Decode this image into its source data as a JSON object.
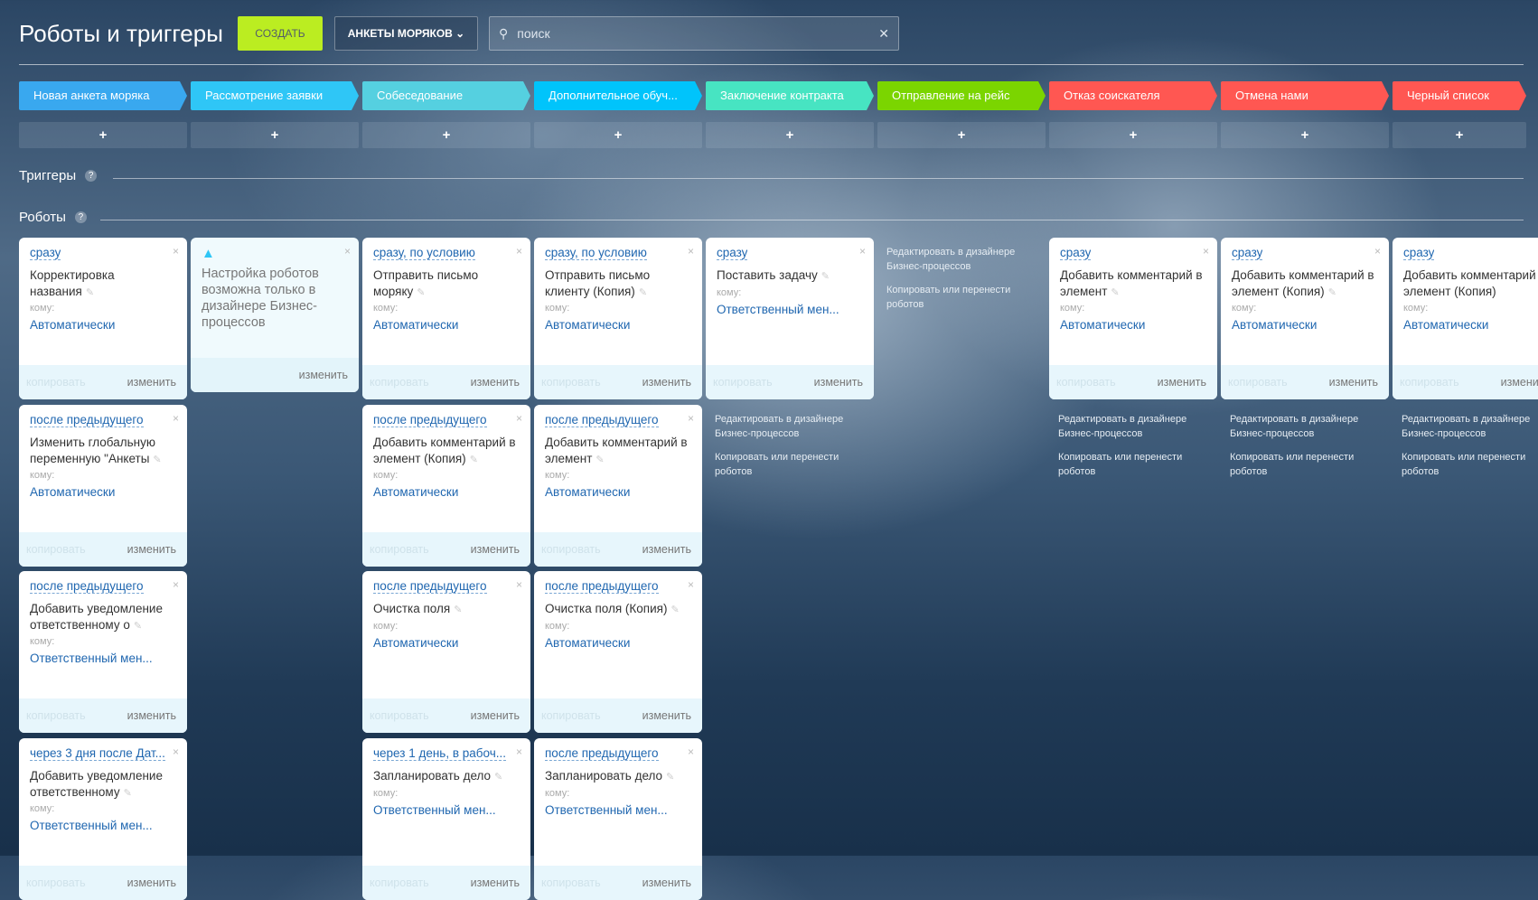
{
  "header": {
    "title": "Роботы и триггеры",
    "create_label": "СОЗДАТЬ",
    "dropdown_label": "АНКЕТЫ МОРЯКОВ",
    "search_placeholder": "поиск"
  },
  "stages": [
    {
      "label": "Новая анкета моряка",
      "color": "#39a8ef"
    },
    {
      "label": "Рассмотрение заявки",
      "color": "#2fc6f6"
    },
    {
      "label": "Собеседование",
      "color": "#55d0e0"
    },
    {
      "label": "Дополнительное обуч...",
      "color": "#00c4fb"
    },
    {
      "label": "Заключение контракта",
      "color": "#47e4c2"
    },
    {
      "label": "Отправление на рейс",
      "color": "#7bd500"
    },
    {
      "label": "Отказ соискателя",
      "color": "#ff5752"
    },
    {
      "label": "Отмена нами",
      "color": "#ff5752"
    },
    {
      "label": "Черный список",
      "color": "#ff5752"
    }
  ],
  "add_label": "+",
  "sections": {
    "triggers": "Триггеры",
    "robots": "Роботы",
    "help": "?"
  },
  "card_labels": {
    "to": "кому:",
    "copy": "копировать",
    "edit": "изменить",
    "close": "×",
    "pencil": "✎"
  },
  "warning": {
    "text": "Настройка роботов возможна только в дизайнере Бизнес-процессов",
    "edit": "изменить"
  },
  "links": {
    "edit_designer": "Редактировать в дизайнере Бизнес-процессов",
    "copy_move": "Копировать или перенести роботов"
  },
  "columns": [
    {
      "cards": [
        {
          "trigger": "сразу",
          "name": "Корректировка названия",
          "to": "Автоматически"
        },
        {
          "trigger": "после предыдущего",
          "name": "Изменить глобальную переменную \"Анкеты",
          "to": "Автоматически"
        },
        {
          "trigger": "после предыдущего",
          "name": "Добавить уведомление ответственному о",
          "to": "Ответственный мен..."
        },
        {
          "trigger": "через 3 дня после Дат...",
          "name": "Добавить уведомление ответственному",
          "to": "Ответственный мен..."
        }
      ]
    },
    {
      "warning": true,
      "cards": []
    },
    {
      "cards": [
        {
          "trigger": "сразу, по условию",
          "name": "Отправить письмо моряку",
          "to": "Автоматически"
        },
        {
          "trigger": "после предыдущего",
          "name": "Добавить комментарий в элемент (Копия)",
          "to": "Автоматически"
        },
        {
          "trigger": "после предыдущего",
          "name": "Очистка поля",
          "to": "Автоматически"
        },
        {
          "trigger": "через 1 день, в рабоч...",
          "name": "Запланировать дело",
          "to": "Ответственный мен..."
        }
      ]
    },
    {
      "cards": [
        {
          "trigger": "сразу, по условию",
          "name": "Отправить письмо клиенту (Копия)",
          "to": "Автоматически"
        },
        {
          "trigger": "после предыдущего",
          "name": "Добавить комментарий в элемент",
          "to": "Автоматически"
        },
        {
          "trigger": "после предыдущего",
          "name": "Очистка поля (Копия)",
          "to": "Автоматически"
        },
        {
          "trigger": "после предыдущего",
          "name": "Запланировать дело",
          "to": "Ответственный мен..."
        }
      ]
    },
    {
      "cards": [
        {
          "trigger": "сразу",
          "name": "Поставить задачу",
          "to": "Ответственный мен..."
        }
      ],
      "links": true
    },
    {
      "cards": [],
      "links": true
    },
    {
      "cards": [
        {
          "trigger": "сразу",
          "name": "Добавить комментарий в элемент",
          "to": "Автоматически"
        }
      ],
      "links": true
    },
    {
      "cards": [
        {
          "trigger": "сразу",
          "name": "Добавить комментарий в элемент (Копия)",
          "to": "Автоматически"
        }
      ],
      "links": true
    },
    {
      "cards": [
        {
          "trigger": "сразу",
          "name": "Добавить комментарий в элемент (Копия) (Копия)",
          "to": "Автоматически"
        }
      ],
      "links": true
    }
  ]
}
